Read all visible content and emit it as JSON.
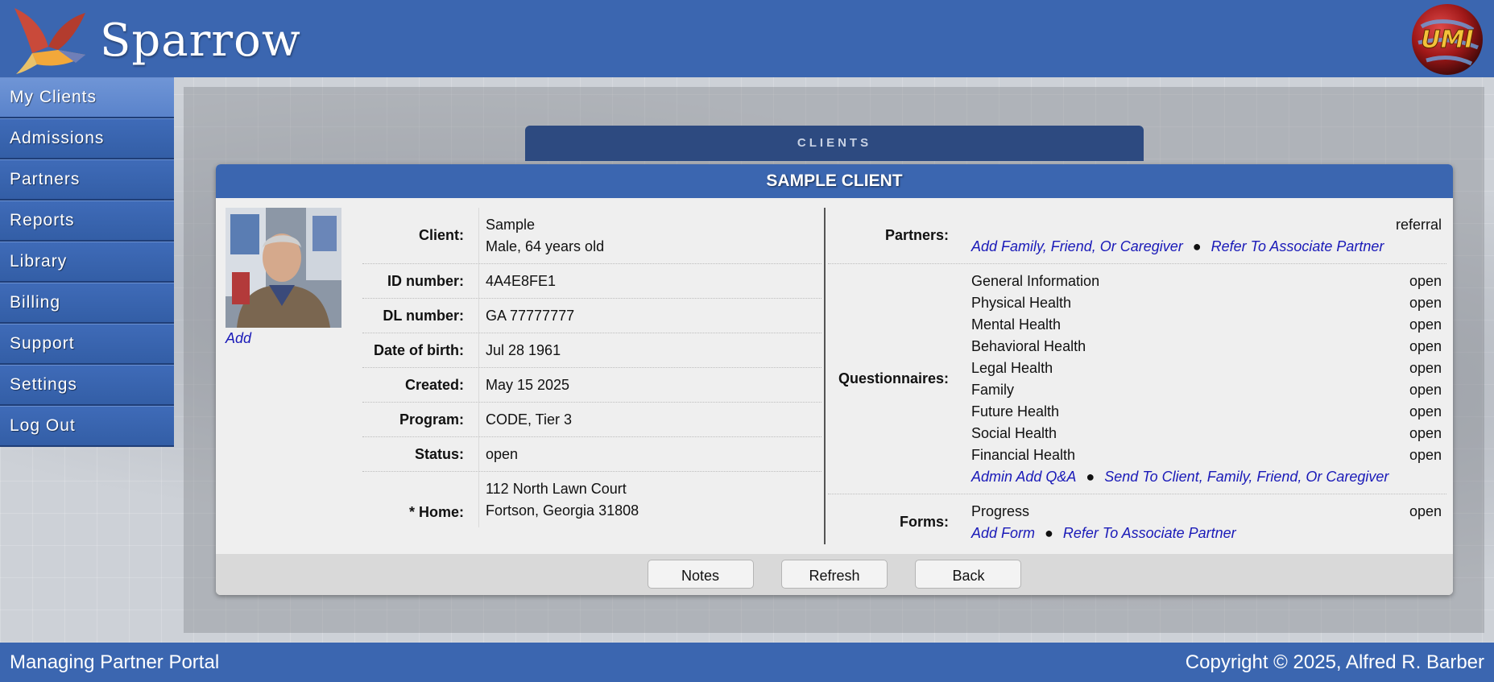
{
  "header": {
    "brand": "Sparrow",
    "partner_logo_text": "UMI"
  },
  "nav": {
    "items": [
      {
        "label": "My Clients"
      },
      {
        "label": "Admissions"
      },
      {
        "label": "Partners"
      },
      {
        "label": "Reports"
      },
      {
        "label": "Library"
      },
      {
        "label": "Billing"
      },
      {
        "label": "Support"
      },
      {
        "label": "Settings"
      },
      {
        "label": "Log Out"
      }
    ]
  },
  "clients_tab": {
    "label": "CLIENTS"
  },
  "modal": {
    "title": "SAMPLE CLIENT",
    "photo_add": "Add",
    "left": {
      "client": {
        "label": "Client:",
        "name": "Sample",
        "detail": "Male, 64 years old"
      },
      "id": {
        "label": "ID number:",
        "value": "4A4E8FE1"
      },
      "dl": {
        "label": "DL number:",
        "value": "GA 77777777"
      },
      "dob": {
        "label": "Date of birth:",
        "value": "Jul 28 1961"
      },
      "created": {
        "label": "Created:",
        "value": "May 15 2025"
      },
      "program": {
        "label": "Program:",
        "value": "CODE, Tier 3"
      },
      "status": {
        "label": "Status:",
        "value": "open"
      },
      "home": {
        "label": "* Home:",
        "line1": "112 North Lawn Court",
        "line2": "Fortson, Georgia 31808"
      }
    },
    "right": {
      "partners": {
        "label": "Partners:",
        "status": "referral",
        "link1": "Add Family, Friend, Or Caregiver",
        "link2": "Refer To Associate Partner"
      },
      "questionnaires": {
        "label": "Questionnaires:",
        "items": [
          {
            "name": "General Information",
            "status": "open"
          },
          {
            "name": "Physical Health",
            "status": "open"
          },
          {
            "name": "Mental Health",
            "status": "open"
          },
          {
            "name": "Behavioral Health",
            "status": "open"
          },
          {
            "name": "Legal Health",
            "status": "open"
          },
          {
            "name": "Family",
            "status": "open"
          },
          {
            "name": "Future Health",
            "status": "open"
          },
          {
            "name": "Social Health",
            "status": "open"
          },
          {
            "name": "Financial Health",
            "status": "open"
          }
        ],
        "link1": "Admin Add Q&A",
        "link2": "Send To Client, Family, Friend, Or Caregiver"
      },
      "forms": {
        "label": "Forms:",
        "item": "Progress",
        "status": "open",
        "link1": "Add Form",
        "link2": "Refer To Associate Partner"
      }
    },
    "buttons": {
      "notes": "Notes",
      "refresh": "Refresh",
      "back": "Back"
    },
    "separator": "●"
  },
  "footer": {
    "left": "Managing Partner Portal",
    "right": "Copyright © 2025, Alfred R. Barber"
  }
}
